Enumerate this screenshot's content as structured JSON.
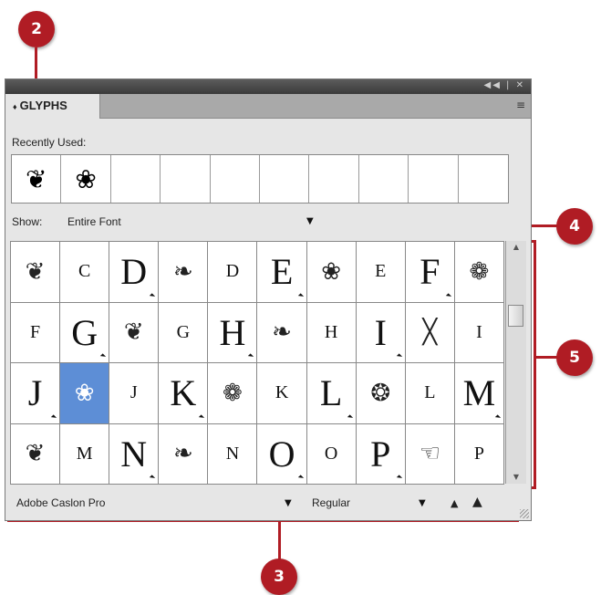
{
  "callouts": {
    "c2": "2",
    "c4": "4",
    "c5": "5",
    "c3": "3"
  },
  "panel": {
    "tab_label": "GLYPHS",
    "tab_prefix": "♦",
    "window_controls": "◀◀ | ✕",
    "menu_icon": "≡",
    "recent_label": "Recently Used:",
    "show_label": "Show:",
    "show_value": "Entire Font",
    "font_family": "Adobe Caslon Pro",
    "font_style": "Regular"
  },
  "recent_glyphs": [
    "❦",
    "❀",
    "",
    "",
    "",
    "",
    "",
    "",
    "",
    ""
  ],
  "glyph_grid": [
    [
      {
        "g": "❦",
        "t": "orn"
      },
      {
        "g": "C",
        "t": "small"
      },
      {
        "g": "D",
        "t": "big",
        "m": true
      },
      {
        "g": "❧",
        "t": "orn"
      },
      {
        "g": "D",
        "t": "small"
      },
      {
        "g": "E",
        "t": "big",
        "m": true
      },
      {
        "g": "❀",
        "t": "orn"
      },
      {
        "g": "E",
        "t": "small"
      },
      {
        "g": "F",
        "t": "big",
        "m": true
      },
      {
        "g": "❁",
        "t": "orn"
      }
    ],
    [
      {
        "g": "F",
        "t": "small"
      },
      {
        "g": "G",
        "t": "big",
        "m": true
      },
      {
        "g": "❦",
        "t": "orn"
      },
      {
        "g": "G",
        "t": "small"
      },
      {
        "g": "H",
        "t": "big",
        "m": true
      },
      {
        "g": "❧",
        "t": "orn"
      },
      {
        "g": "H",
        "t": "small"
      },
      {
        "g": "I",
        "t": "big",
        "m": true
      },
      {
        "g": "╳",
        "t": "orn"
      },
      {
        "g": "I",
        "t": "small"
      }
    ],
    [
      {
        "g": "J",
        "t": "big",
        "m": true
      },
      {
        "g": "❀",
        "t": "orn",
        "sel": true
      },
      {
        "g": "J",
        "t": "small"
      },
      {
        "g": "K",
        "t": "big",
        "m": true
      },
      {
        "g": "❁",
        "t": "orn"
      },
      {
        "g": "K",
        "t": "small"
      },
      {
        "g": "L",
        "t": "big",
        "m": true
      },
      {
        "g": "❂",
        "t": "orn"
      },
      {
        "g": "L",
        "t": "small"
      },
      {
        "g": "M",
        "t": "big",
        "m": true
      }
    ],
    [
      {
        "g": "❦",
        "t": "orn"
      },
      {
        "g": "M",
        "t": "small"
      },
      {
        "g": "N",
        "t": "big",
        "m": true
      },
      {
        "g": "❧",
        "t": "orn"
      },
      {
        "g": "N",
        "t": "small"
      },
      {
        "g": "O",
        "t": "big",
        "m": true
      },
      {
        "g": "O",
        "t": "small"
      },
      {
        "g": "P",
        "t": "big",
        "m": true
      },
      {
        "g": "☜",
        "t": "orn"
      },
      {
        "g": "P",
        "t": "small"
      }
    ]
  ]
}
